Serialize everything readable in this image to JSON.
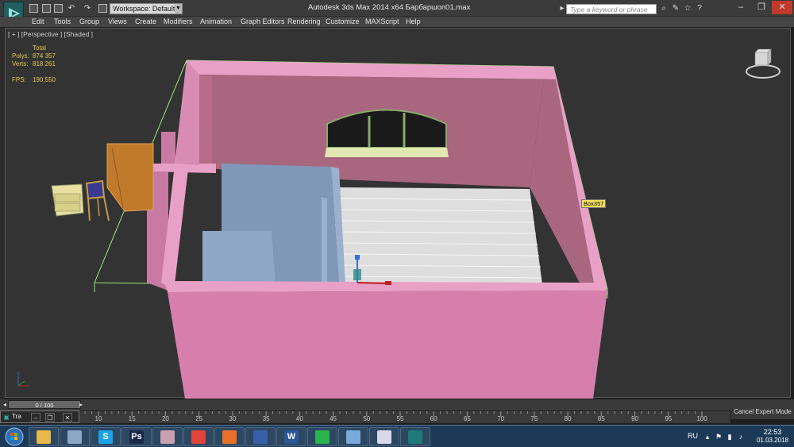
{
  "titlebar": {
    "workspace_label": "Workspace: Default",
    "window_title": "Autodesk 3ds Max  2014 x64      Барбаршоп01.max",
    "search_placeholder": "Type a keyword or phrase"
  },
  "menu": [
    "Edit",
    "Tools",
    "Group",
    "Views",
    "Create",
    "Modifiers",
    "Animation",
    "Graph Editors",
    "Rendering",
    "Customize",
    "MAXScript",
    "Help"
  ],
  "viewport": {
    "label": "[ + ] [Perspective ] [Shaded ]",
    "stats": {
      "total_label": "Total",
      "polys_label": "Polys:",
      "polys_value": "874 357",
      "verts_label": "Verts:",
      "verts_value": "818 261",
      "fps_label": "FPS:",
      "fps_value": "190,550"
    },
    "object_tooltip": "Box357"
  },
  "timeline": {
    "slider_label": "0 / 100",
    "ticks": [
      "10",
      "15",
      "20",
      "25",
      "30",
      "35",
      "40",
      "45",
      "50",
      "55",
      "60",
      "65",
      "70",
      "75",
      "80",
      "85",
      "90",
      "95",
      "100"
    ],
    "mini_window_label": "Tra",
    "cancel_expert_label": "Cancel Expert Mode"
  },
  "taskbar": {
    "apps": [
      {
        "name": "explorer",
        "glyph": "",
        "color": "#e8b84a"
      },
      {
        "name": "calculator",
        "glyph": "",
        "color": "#8aa7c8"
      },
      {
        "name": "skype",
        "glyph": "S",
        "color": "#1aa3e6"
      },
      {
        "name": "photoshop",
        "glyph": "Ps",
        "color": "#1b2a4a"
      },
      {
        "name": "app-pink",
        "glyph": "",
        "color": "#c8a0b0"
      },
      {
        "name": "chrome",
        "glyph": "",
        "color": "#e0443a"
      },
      {
        "name": "firefox",
        "glyph": "",
        "color": "#e8702a"
      },
      {
        "name": "floppy",
        "glyph": "",
        "color": "#3a5fa8"
      },
      {
        "name": "word",
        "glyph": "W",
        "color": "#2b5797"
      },
      {
        "name": "whatsapp",
        "glyph": "",
        "color": "#29b34a"
      },
      {
        "name": "image-viewer",
        "glyph": "",
        "color": "#7aa8d8"
      },
      {
        "name": "pdf",
        "glyph": "",
        "color": "#d8d8e8"
      },
      {
        "name": "3dsmax",
        "glyph": "",
        "color": "#1f7a7c"
      }
    ],
    "language": "RU",
    "time": "22:53",
    "date": "01.03.2018"
  },
  "colors": {
    "wall_outer": "#d77fac",
    "wall_inner": "#a8667f",
    "wall_top": "#e9a0c6",
    "floor": "#dedede",
    "partition": "#7f98b8",
    "bbox": "#9be87c",
    "door": "#c07a2a"
  }
}
